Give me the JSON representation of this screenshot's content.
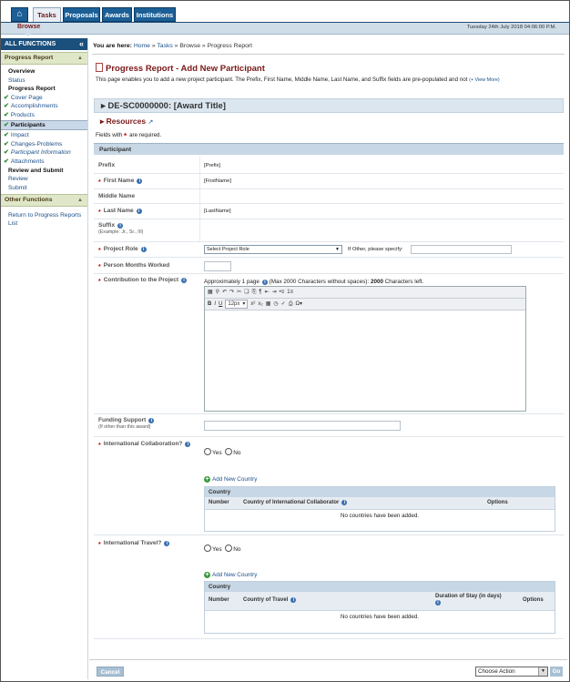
{
  "nav": {
    "tabs": [
      "Tasks",
      "Proposals",
      "Awards",
      "Institutions"
    ],
    "sub": "Browse",
    "date": "Tuesday 24th July 2018 04:06:00 P.M."
  },
  "sidebar": {
    "header": "ALL FUNCTIONS",
    "section1": "Progress Report",
    "items": [
      "Overview",
      "Status",
      "Progress Report",
      "Cover Page",
      "Accomplishments",
      "Products",
      "Participants",
      "Impact",
      "Changes-Problems",
      "Participant Information",
      "Attachments",
      "Review and Submit",
      "Review",
      "Submit"
    ],
    "section2": "Other Functions",
    "other": [
      "Return to Progress Reports List"
    ]
  },
  "breadcrumb": {
    "lead": "You are here:",
    "home": "Home",
    "tasks": "Tasks",
    "browse": "Browse",
    "current": "Progress Report"
  },
  "page": {
    "title": "Progress Report - Add New Participant",
    "desc": "This page enables you to add a new project participant. The Prefix, First Name, Middle Name, Last Name, and Suffix fields are pre-populated and not",
    "view_more": "(+ View More)",
    "award": "DE-SC0000000: [Award Title]",
    "resources": "Resources",
    "required_a": "Fields with",
    "required_b": "are required.",
    "section": "Participant"
  },
  "form": {
    "prefix_label": "Prefix",
    "prefix_val": "[Prefix]",
    "first_label": "First Name",
    "first_val": "[FirstName]",
    "middle_label": "Middle Name",
    "last_label": "Last Name",
    "last_val": "[LastName]",
    "suffix_label": "Suffix",
    "suffix_hint": "(Example: Jr., Sr., III)",
    "role_label": "Project Role",
    "role_select": "Select Project Role",
    "role_other": "If Other, please specify:",
    "months_label": "Person Months Worked",
    "contrib_label": "Contribution to the Project",
    "contrib_hint_a": "Approximately 1 page",
    "contrib_hint_b": "(Max 2000 Characters without spaces):",
    "contrib_count": "2000",
    "contrib_hint_c": "Characters left.",
    "font_size": "12px",
    "funding_label": "Funding Support",
    "funding_hint": "(If other than this award)",
    "intl_collab_label": "International Collaboration?",
    "intl_travel_label": "International Travel?",
    "yes": "Yes",
    "no": "No",
    "add_country": "Add New Country",
    "country_head": "Country",
    "col_number": "Number",
    "col_collab_country": "Country of International Collaborator",
    "col_options": "Options",
    "no_countries": "No countries have been added.",
    "col_travel_country": "Country of Travel",
    "col_duration": "Duration of Stay (in days)"
  },
  "footer": {
    "cancel": "Cancel",
    "choose": "Choose Action",
    "go": "Go"
  }
}
